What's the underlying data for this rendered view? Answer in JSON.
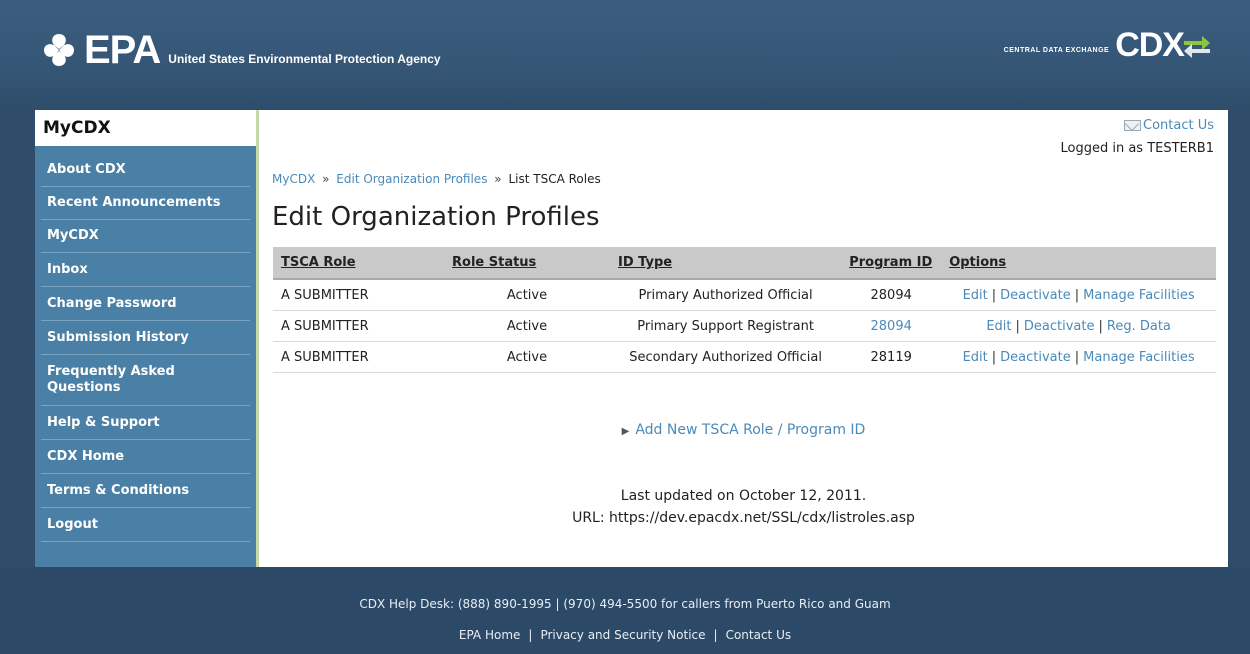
{
  "header": {
    "epa_word": "EPA",
    "epa_tagline": "United States Environmental Protection Agency",
    "cdx_small": "CENTRAL DATA EXCHANGE",
    "cdx_word": "CDX"
  },
  "sidebar": {
    "title": "MyCDX",
    "items": [
      {
        "label": "About CDX"
      },
      {
        "label": "Recent Announcements"
      },
      {
        "label": "MyCDX"
      },
      {
        "label": "Inbox"
      },
      {
        "label": "Change Password"
      },
      {
        "label": "Submission History"
      },
      {
        "label": "Frequently Asked Questions"
      },
      {
        "label": "Help & Support"
      },
      {
        "label": "CDX Home"
      },
      {
        "label": "Terms & Conditions"
      },
      {
        "label": "Logout"
      }
    ]
  },
  "main": {
    "contact_us": "Contact Us",
    "logged_in": "Logged in as TESTERB1",
    "breadcrumb": {
      "item1": "MyCDX",
      "item2": "Edit Organization Profiles",
      "current": "List TSCA Roles",
      "separator": "»"
    },
    "title": "Edit Organization Profiles",
    "table": {
      "headers": [
        "TSCA Role",
        "Role Status",
        "ID Type",
        "Program ID",
        "Options"
      ],
      "rows": [
        {
          "role": "A SUBMITTER",
          "status": "Active",
          "id_type": "Primary Authorized Official",
          "program_id": "28094",
          "options": [
            "Edit",
            "Deactivate",
            "Manage Facilities"
          ]
        },
        {
          "role": "A SUBMITTER",
          "status": "Active",
          "id_type": "Primary Support Registrant",
          "program_id": "28094",
          "options": [
            "Edit",
            "Deactivate",
            "Reg. Data"
          ]
        },
        {
          "role": "A SUBMITTER",
          "status": "Active",
          "id_type": "Secondary Authorized Official",
          "program_id": "28119",
          "options": [
            "Edit",
            "Deactivate",
            "Manage Facilities"
          ]
        }
      ]
    },
    "add_link": "Add New TSCA Role / Program ID",
    "last_updated": "Last updated on October 12, 2011.",
    "url": "URL: https://dev.epacdx.net/SSL/cdx/listroles.asp"
  },
  "footer": {
    "helpdesk": "CDX Help Desk: (888) 890-1995 | (970) 494-5500 for callers from Puerto Rico and Guam",
    "links": [
      "EPA Home",
      "Privacy and Security Notice",
      "Contact Us"
    ]
  },
  "colors": {
    "page_bg": "#2f4d6b",
    "sidebar_bg": "#4a7fa6",
    "link": "#4b8ab8",
    "table_header": "#c9c9c9"
  }
}
